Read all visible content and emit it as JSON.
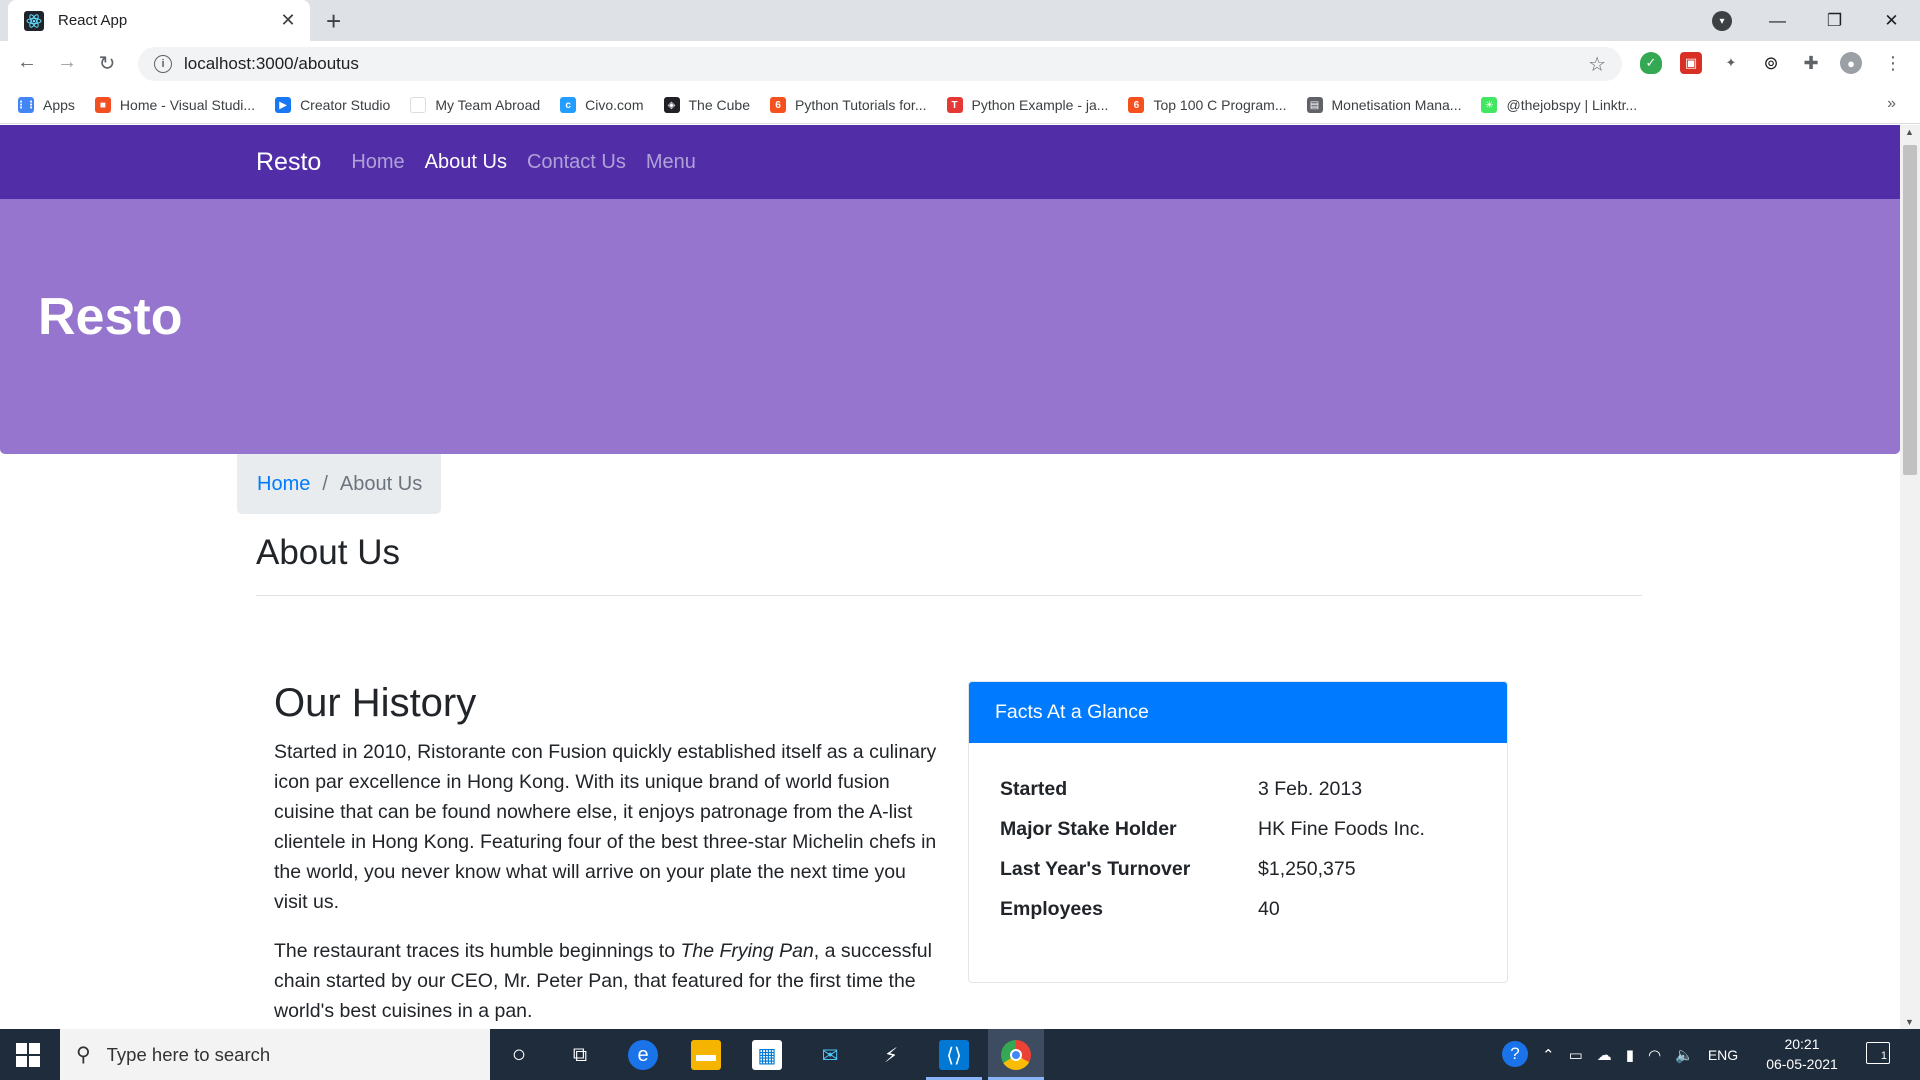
{
  "browser": {
    "tab_title": "React App",
    "url": "localhost:3000/aboutus",
    "bookmarks": [
      {
        "label": "Apps",
        "icon": "apps-grid-icon",
        "color": "#4285f4"
      },
      {
        "label": "Home - Visual Studi...",
        "icon": "microsoft-icon",
        "color": "#f25022"
      },
      {
        "label": "Creator Studio",
        "icon": "creator-studio-icon",
        "color": "#1877f2"
      },
      {
        "label": "My Team Abroad",
        "icon": "blank-page-icon",
        "color": "#ffffff"
      },
      {
        "label": "Civo.com",
        "icon": "civo-icon",
        "color": "#239dff"
      },
      {
        "label": "The Cube",
        "icon": "cube-icon",
        "color": "#202124"
      },
      {
        "label": "Python Tutorials for...",
        "icon": "python-tutorials-icon",
        "color": "#f4511e"
      },
      {
        "label": "Python Example - ja...",
        "icon": "javatpoint-icon",
        "color": "#e53935"
      },
      {
        "label": "Top 100 C Program...",
        "icon": "c-program-icon",
        "color": "#f4511e"
      },
      {
        "label": "Monetisation Mana...",
        "icon": "monetisation-icon",
        "color": "#5f6368"
      },
      {
        "label": "@thejobspy | Linktr...",
        "icon": "linktree-icon",
        "color": "#43e660"
      }
    ]
  },
  "site": {
    "brand": "Resto",
    "nav": [
      "Home",
      "About Us",
      "Contact Us",
      "Menu"
    ],
    "active_nav": "About Us",
    "jumbotron_title": "Resto",
    "breadcrumb": {
      "home": "Home",
      "current": "About Us"
    },
    "page_heading": "About Us",
    "history": {
      "heading": "Our History",
      "para1": "Started in 2010, Ristorante con Fusion quickly established itself as a culinary icon par excellence in Hong Kong. With its unique brand of world fusion cuisine that can be found nowhere else, it enjoys patronage from the A-list clientele in Hong Kong. Featuring four of the best three-star Michelin chefs in the world, you never know what will arrive on your plate the next time you visit us.",
      "para2_before": "The restaurant traces its humble beginnings to ",
      "para2_italic": "The Frying Pan",
      "para2_after": ", a successful chain started by our CEO, Mr. Peter Pan, that featured for the first time the world's best cuisines in a pan."
    },
    "facts": {
      "title": "Facts At a Glance",
      "rows": [
        {
          "label": "Started",
          "value": "3 Feb. 2013"
        },
        {
          "label": "Major Stake Holder",
          "value": "HK Fine Foods Inc."
        },
        {
          "label": "Last Year's Turnover",
          "value": "$1,250,375"
        },
        {
          "label": "Employees",
          "value": "40"
        }
      ]
    },
    "colors": {
      "navbar": "#512da8",
      "jumbotron": "#9575cd",
      "card_header": "#007bff",
      "link": "#007bff"
    }
  },
  "taskbar": {
    "search_placeholder": "Type here to search",
    "language": "ENG",
    "time": "20:21",
    "date": "06-05-2021",
    "notifications": "1"
  }
}
